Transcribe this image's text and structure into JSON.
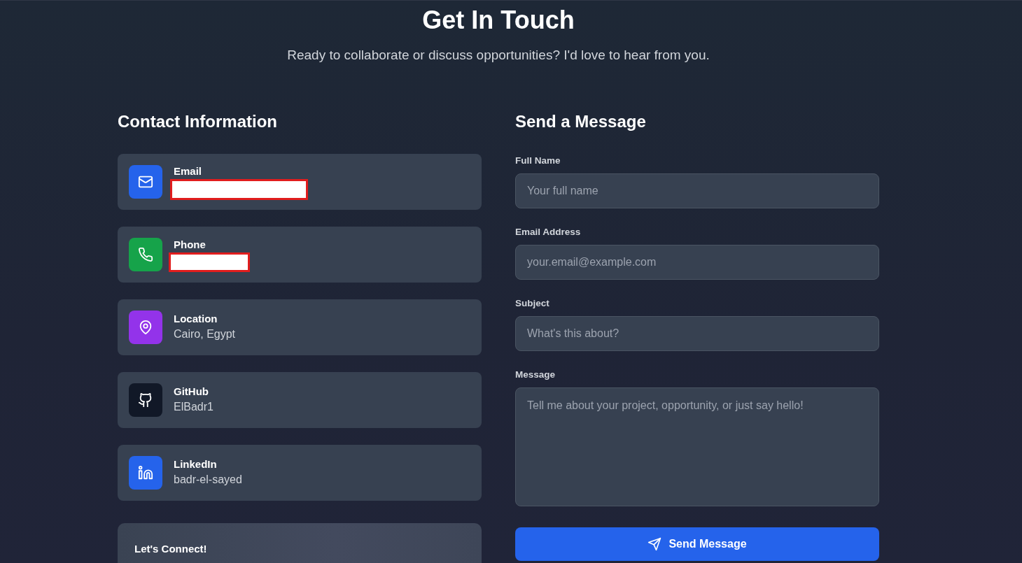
{
  "header": {
    "title": "Get In Touch",
    "subtitle": "Ready to collaborate or discuss opportunities? I'd love to hear from you."
  },
  "contact": {
    "heading": "Contact Information",
    "items": [
      {
        "kind": "email",
        "label": "Email",
        "redacted": true,
        "color": "#2563eb"
      },
      {
        "kind": "phone",
        "label": "Phone",
        "redacted": true,
        "color": "#16a34a"
      },
      {
        "kind": "location",
        "label": "Location",
        "value": "Cairo, Egypt",
        "redacted": false,
        "color": "#9333ea"
      },
      {
        "kind": "github",
        "label": "GitHub",
        "value": "ElBadr1",
        "redacted": false,
        "color": "#111827"
      },
      {
        "kind": "linkedin",
        "label": "LinkedIn",
        "value": "badr-el-sayed",
        "redacted": false,
        "color": "#2563eb"
      }
    ],
    "connect": {
      "title": "Let's Connect!"
    }
  },
  "form": {
    "heading": "Send a Message",
    "fields": [
      {
        "kind": "input",
        "label": "Full Name",
        "placeholder": "Your full name"
      },
      {
        "kind": "input",
        "label": "Email Address",
        "placeholder": "your.email@example.com"
      },
      {
        "kind": "input",
        "label": "Subject",
        "placeholder": "What's this about?"
      },
      {
        "kind": "textarea",
        "label": "Message",
        "placeholder": "Tell me about your project, opportunity, or just say hello!"
      }
    ],
    "submit": "Send Message"
  }
}
